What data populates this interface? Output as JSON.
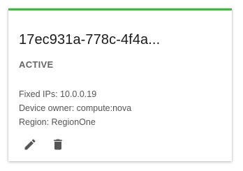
{
  "card": {
    "title": "17ec931a-778c-4f4a...",
    "status": "ACTIVE",
    "details": [
      "Fixed IPs: 10.0.0.19",
      "Device owner: compute:nova",
      "Region: RegionOne"
    ],
    "accent_color": "#4caf50",
    "actions": [
      {
        "icon": "pencil-icon"
      },
      {
        "icon": "trash-icon"
      }
    ]
  }
}
